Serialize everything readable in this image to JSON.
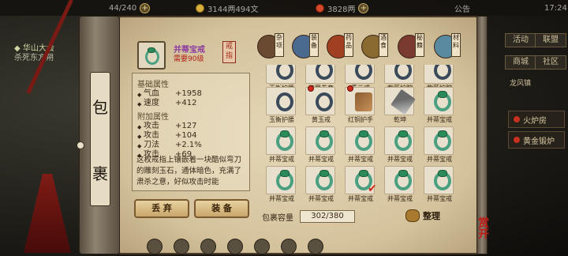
{
  "status": {
    "energy": "44/240",
    "silver": "3144两494文",
    "gold": "3828两",
    "notice": "公告",
    "clock": "17:24"
  },
  "left_info": {
    "line1": "◆ 华山大会",
    "line2": "杀死东方朔"
  },
  "right_panel": {
    "btn1": "活动",
    "btn2": "联盟",
    "btn3": "商城",
    "btn4": "社区",
    "dragon_label": "龙风镇",
    "item1": "火炉房",
    "item2": "黄金锻炉"
  },
  "roller": {
    "char1": "包",
    "char2": "裹"
  },
  "selected": {
    "name": "并蒂宝戒",
    "requirement": "需要90级",
    "seal": "戒指"
  },
  "base_attrs": {
    "title": "基础属性",
    "items": [
      {
        "k": "气血",
        "v": "+1958"
      },
      {
        "k": "速度",
        "v": "+412"
      }
    ]
  },
  "extra_attrs": {
    "title": "附加属性",
    "items": [
      {
        "k": "攻击",
        "v": "+127"
      },
      {
        "k": "攻击",
        "v": "+104"
      },
      {
        "k": "刀法",
        "v": "+2.1%"
      },
      {
        "k": "攻击",
        "v": "+69"
      }
    ]
  },
  "description": "这枚戒指上镶嵌着一块酷似弯刀的雕刻玉石，通体暗色，充满了肃杀之意，好似攻击时能",
  "buttons": {
    "discard": "丢 弃",
    "equip": "装 备"
  },
  "categories": [
    "杂项",
    "装备",
    "药品",
    "酒食",
    "秘籍",
    "材料"
  ],
  "grid_labels": [
    [
      "玉衡护腰",
      "修罗拳套",
      "青云戒",
      "紫薇护腕",
      "紫薇护腕"
    ],
    [
      "玉衡护腰",
      "黄玉戒",
      "红铜护手",
      "乾坤",
      "并蒂宝戒"
    ],
    [
      "并蒂宝戒",
      "并蒂宝戒",
      "并蒂宝戒",
      "并蒂宝戒",
      "并蒂宝戒"
    ],
    [
      "并蒂宝戒",
      "并蒂宝戒",
      "并蒂宝戒",
      "并蒂宝戒",
      "并蒂宝戒"
    ]
  ],
  "capacity": {
    "label": "包裹容量",
    "value": "302/380"
  },
  "sort_label": "整理",
  "stamp": "赏开"
}
